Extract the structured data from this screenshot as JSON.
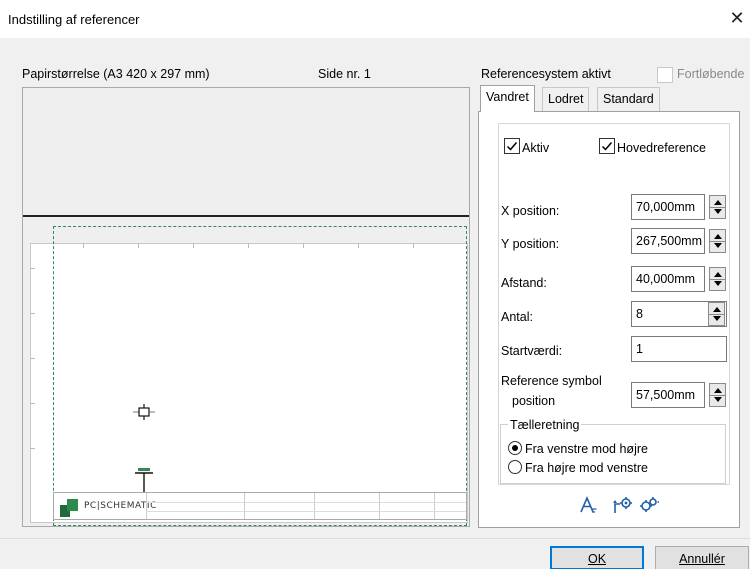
{
  "window": {
    "title": "Indstilling af referencer",
    "close_glyph": "✕"
  },
  "preview": {
    "paper_label": "Papirstørrelse (A3 420 x 297 mm)",
    "page_label": "Side nr. 1",
    "logo_text": "PC|SCHEMATIC"
  },
  "refsys": {
    "label": "Referencesystem aktivt",
    "continuous_label": "Fortløbende",
    "continuous_checked": false
  },
  "tabs": [
    {
      "label": "Vandret",
      "active": true
    },
    {
      "label": "Lodret",
      "active": false
    },
    {
      "label": "Standard",
      "active": false
    }
  ],
  "form": {
    "active_label": "Aktiv",
    "active_checked": true,
    "main_ref_label": "Hovedreference",
    "main_ref_checked": true,
    "x_label": "X position:",
    "x_value": "70,000mm",
    "y_label": "Y position:",
    "y_value": "267,500mm",
    "spacing_label": "Afstand:",
    "spacing_value": "40,000mm",
    "count_label": "Antal:",
    "count_value": "8",
    "start_label": "Startværdi:",
    "start_value": "1",
    "refsym_label_1": "Reference symbol",
    "refsym_label_2": "position",
    "refsym_value": "57,500mm",
    "direction_legend": "Tælleretning",
    "dir_ltr": "Fra venstre mod højre",
    "dir_rtl": "Fra højre mod venstre",
    "dir_selected": "ltr"
  },
  "icons": [
    "font-icon",
    "settings-arrow-icon",
    "gears-icon"
  ],
  "buttons": {
    "ok": "OK",
    "cancel": "Annullér"
  },
  "colors": {
    "accent": "#0078d7",
    "guide": "#2e8b57"
  }
}
